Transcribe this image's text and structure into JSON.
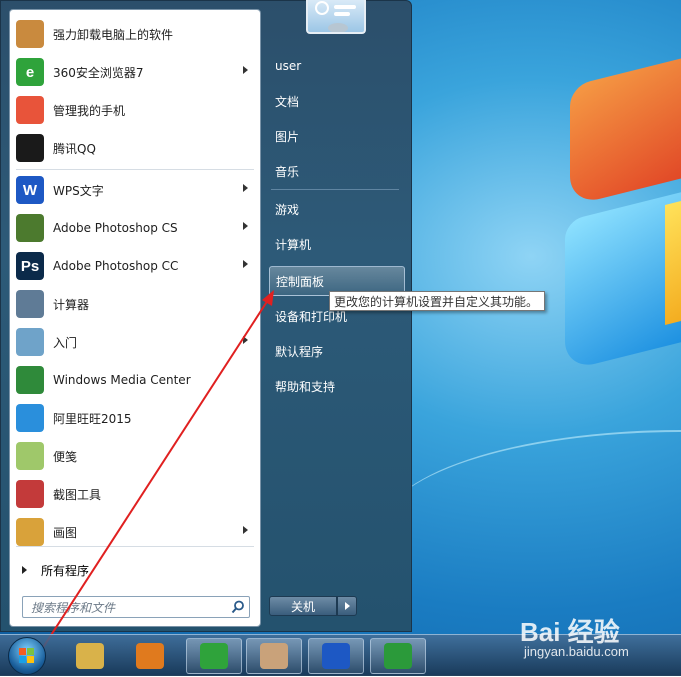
{
  "start_menu": {
    "programs": [
      {
        "label": "强力卸载电脑上的软件",
        "icon": "uninstaller-icon",
        "color": "#c98a3e",
        "has_arrow": false
      },
      {
        "label": "360安全浏览器7",
        "icon": "360-browser-icon",
        "color": "#2fa33b",
        "has_arrow": true
      },
      {
        "label": "管理我的手机",
        "icon": "phone-manager-icon",
        "color": "#e8543a",
        "has_arrow": false
      },
      {
        "label": "腾讯QQ",
        "icon": "qq-icon",
        "color": "#1a1a1a",
        "has_arrow": false
      },
      {
        "label": "WPS文字",
        "icon": "wps-writer-icon",
        "color": "#1d58c4",
        "has_arrow": true
      },
      {
        "label": "Adobe Photoshop CS",
        "icon": "photoshop-cs-icon",
        "color": "#4c7a2e",
        "has_arrow": true
      },
      {
        "label": "Adobe Photoshop CC",
        "icon": "photoshop-cc-icon",
        "color": "#0b2a4a",
        "has_arrow": true
      },
      {
        "label": "计算器",
        "icon": "calculator-icon",
        "color": "#5f7b96",
        "has_arrow": false
      },
      {
        "label": "入门",
        "icon": "getting-started-icon",
        "color": "#6fa3c9",
        "has_arrow": true
      },
      {
        "label": "Windows Media Center",
        "icon": "media-center-icon",
        "color": "#2f8a3a",
        "has_arrow": false
      },
      {
        "label": "阿里旺旺2015",
        "icon": "aliwangwang-icon",
        "color": "#2a8fdc",
        "has_arrow": false
      },
      {
        "label": "便笺",
        "icon": "sticky-notes-icon",
        "color": "#9fc86a",
        "has_arrow": false
      },
      {
        "label": "截图工具",
        "icon": "snipping-tool-icon",
        "color": "#c33a3a",
        "has_arrow": false
      },
      {
        "label": "画图",
        "icon": "paint-icon",
        "color": "#d9a23a",
        "has_arrow": true
      }
    ],
    "programs_glyph": [
      "",
      "e",
      "",
      "",
      "W",
      "",
      "Ps",
      "",
      "",
      "",
      "",
      "",
      "",
      ""
    ],
    "all_programs_label": "所有程序",
    "search_placeholder": "搜索程序和文件",
    "right_items": [
      "user",
      "文档",
      "图片",
      "音乐",
      "游戏",
      "计算机",
      "控制面板",
      "设备和打印机",
      "默认程序",
      "帮助和支持"
    ],
    "highlighted_item": "控制面板",
    "shutdown_label": "关机",
    "tooltip": "更改您的计算机设置并自定义其功能。"
  },
  "taskbar": {
    "items": [
      {
        "icon": "explorer-icon"
      },
      {
        "icon": "media-player-icon"
      },
      {
        "icon": "360-browser-icon"
      },
      {
        "icon": "blurred-app-icon"
      },
      {
        "icon": "wps-writer-icon"
      },
      {
        "icon": "wps-spreadsheet-icon"
      }
    ]
  },
  "watermark": {
    "brand": "Bai 经验",
    "url": "jingyan.baidu.com"
  },
  "colors": {
    "accent_red": "#e02020",
    "menu_blue": "#2c4f6b"
  }
}
